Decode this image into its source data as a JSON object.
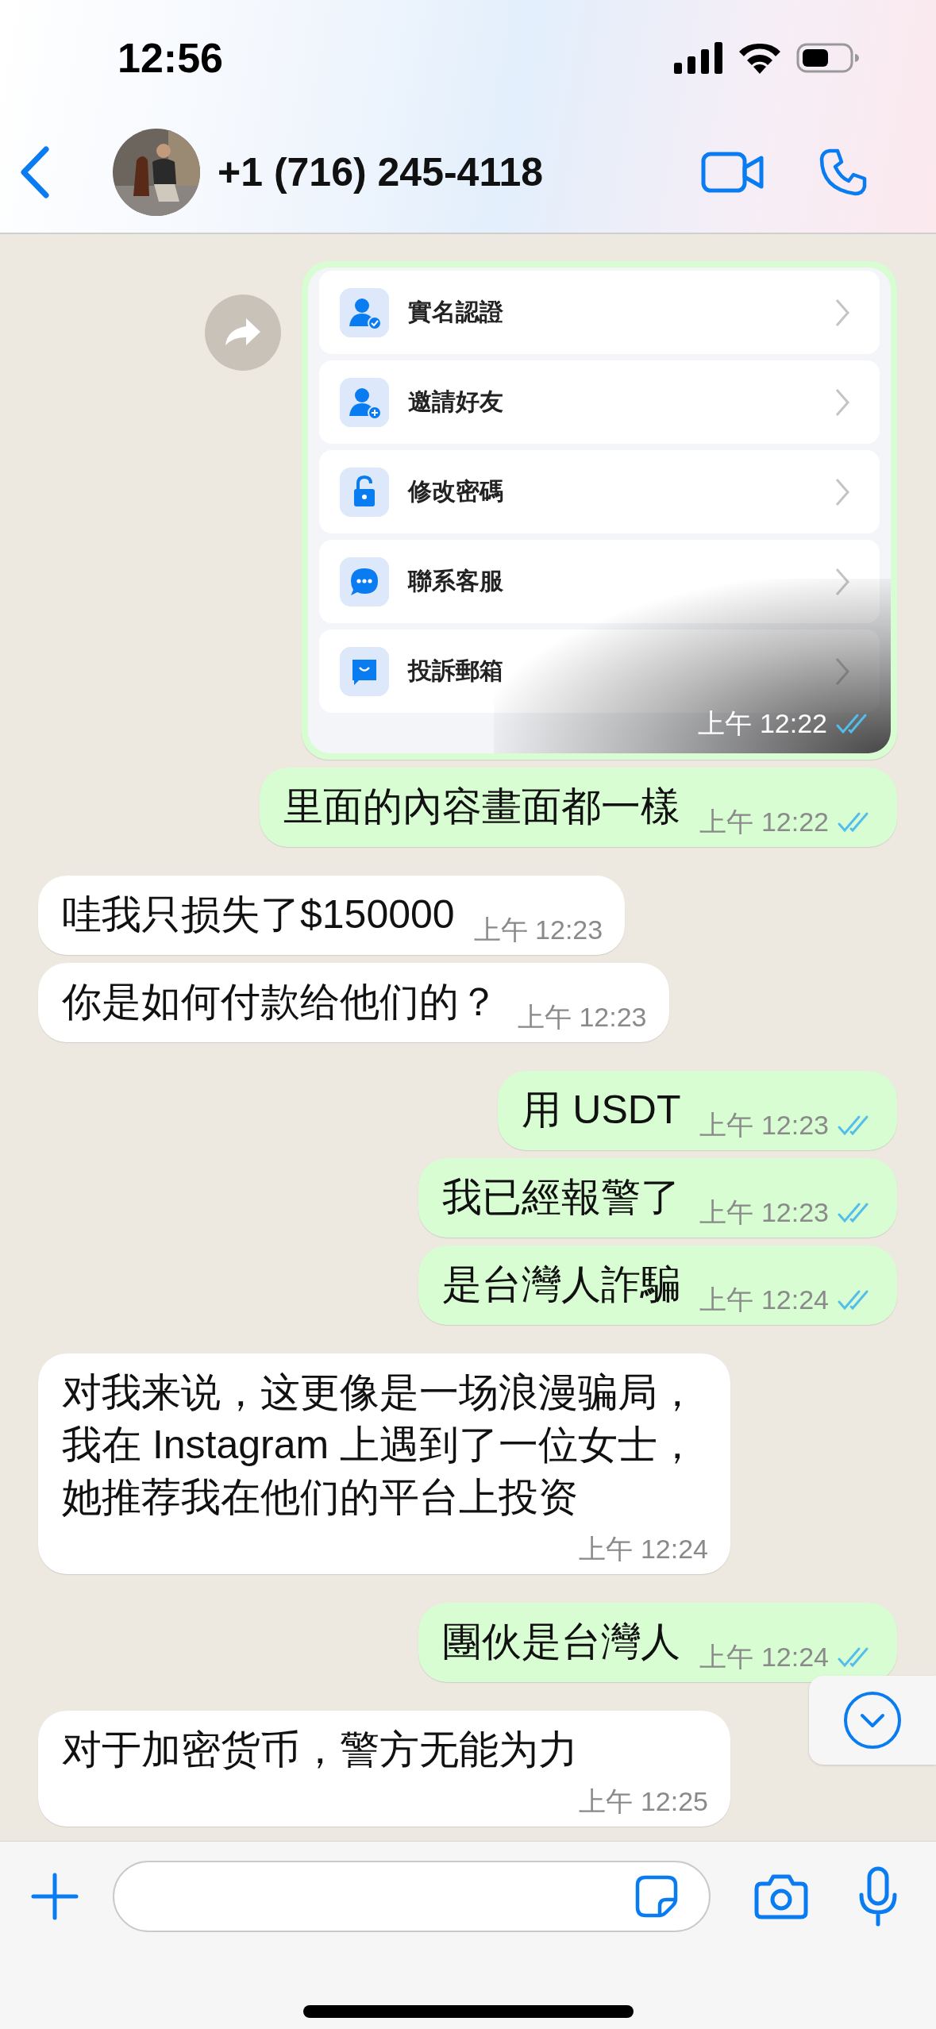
{
  "status_bar": {
    "time": "12:56"
  },
  "header": {
    "contact": "+1 (716) 245-4118"
  },
  "messages": [
    {
      "outgoing": true,
      "rows": [
        {
          "label": "實名認證"
        },
        {
          "label": "邀請好友"
        },
        {
          "label": "修改密碼"
        },
        {
          "label": "聯系客服"
        },
        {
          "label": "投訴郵箱"
        }
      ],
      "time": "上午 12:22",
      "read": true
    },
    {
      "kind": "text",
      "outgoing": true,
      "text": "里面的內容畫面都一樣",
      "time": "上午 12:22",
      "read": true
    },
    {
      "kind": "text",
      "outgoing": false,
      "text": "哇我只损失了$150000",
      "time": "上午 12:23"
    },
    {
      "kind": "text",
      "outgoing": false,
      "text": "你是如何付款给他们的？",
      "time": "上午 12:23"
    },
    {
      "kind": "text",
      "outgoing": true,
      "text": "用 USDT",
      "time": "上午 12:23",
      "read": true
    },
    {
      "kind": "text",
      "outgoing": true,
      "text": "我已經報警了",
      "time": "上午 12:23",
      "read": true
    },
    {
      "kind": "text",
      "outgoing": true,
      "text": "是台灣人詐騙",
      "time": "上午 12:24",
      "read": true
    },
    {
      "kind": "text",
      "outgoing": false,
      "text": "对我来说，这更像是一场浪漫骗局，我在 Instagram 上遇到了一位女士，她推荐我在他们的平台上投资",
      "time": "上午 12:24"
    },
    {
      "kind": "text",
      "outgoing": true,
      "text": "團伙是台灣人",
      "time": "上午 12:24",
      "read": true
    },
    {
      "kind": "text",
      "outgoing": false,
      "text": "对于加密货币，警方无能为力",
      "time": "上午 12:25"
    }
  ]
}
